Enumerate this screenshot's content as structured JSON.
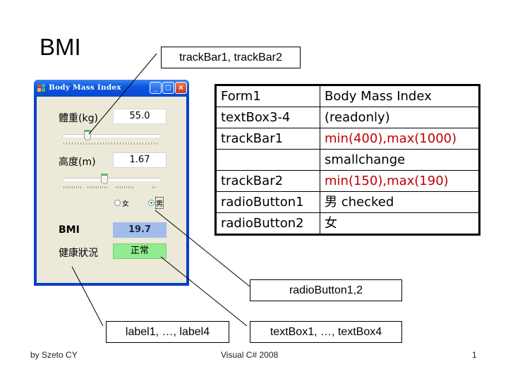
{
  "slide": {
    "title": "BMI",
    "footer": {
      "author": "by Szeto CY",
      "center": "Visual C# 2008",
      "page_number": "1"
    }
  },
  "callouts": {
    "trackbars": "trackBar1, trackBar2",
    "radio_buttons": "radioButton1,2",
    "labels": "label1, …, label4",
    "textboxes": "textBox1, …, textBox4"
  },
  "window": {
    "title": "Body Mass Index",
    "controls": {
      "minimize": "_",
      "maximize": "□",
      "close": "×"
    },
    "weight": {
      "label": "體重(kg)",
      "value": "55.0",
      "slider_fraction": 0.25
    },
    "height": {
      "label": "高度(m)",
      "value": "1.67",
      "slider_fraction": 0.425
    },
    "gender": {
      "options": [
        {
          "label": "女",
          "checked": false
        },
        {
          "label": "男",
          "checked": true
        }
      ]
    },
    "bmi": {
      "label": "BMI",
      "value": "19.7",
      "color": "#a4bcec"
    },
    "status": {
      "label": "健康狀況",
      "value": "正常",
      "color": "#90ec90"
    }
  },
  "properties_table": {
    "rows": [
      {
        "name": "Form1",
        "value": "Body Mass Index",
        "highlight": false
      },
      {
        "name": "textBox3-4",
        "value": "(readonly)",
        "highlight": false
      },
      {
        "name": "trackBar1",
        "value": "min(400),max(1000)",
        "highlight": true
      },
      {
        "name": "",
        "value": "smallchange",
        "highlight": false
      },
      {
        "name": "trackBar2",
        "value": "min(150),max(190)",
        "highlight": true
      },
      {
        "name": "radioButton1",
        "value": "男 checked",
        "highlight": false
      },
      {
        "name": "radioButton2",
        "value": "女",
        "highlight": false
      }
    ],
    "highlight_color": "#c00000"
  }
}
